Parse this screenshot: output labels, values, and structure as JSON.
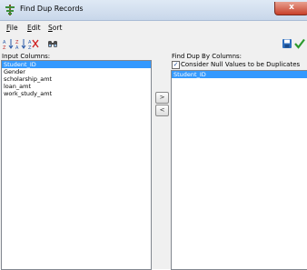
{
  "window": {
    "title": "Find Dup Records",
    "close_label": "x"
  },
  "menu": [
    {
      "label": "File",
      "mnemonic": "F"
    },
    {
      "label": "Edit",
      "mnemonic": "E"
    },
    {
      "label": "Sort",
      "mnemonic": "S"
    }
  ],
  "toolbar": {
    "icons": [
      "sort-ascending-icon",
      "sort-descending-icon",
      "clear-sort-icon",
      "find-icon",
      "save-icon",
      "apply-check-icon"
    ]
  },
  "left": {
    "label": "Input Columns:",
    "items": [
      "Student_ID",
      "Gender",
      "scholarship_amt",
      "loan_amt",
      "work_study_amt"
    ],
    "selected_index": 0
  },
  "buttons": {
    "add": ">",
    "remove": "<"
  },
  "right": {
    "label": "Find Dup By Columns:",
    "checkbox_label": "Consider Null Values to be Duplicates",
    "checkbox_checked": true,
    "check_mark": "✓",
    "items": [
      "Student_ID"
    ],
    "selected_index": 0
  },
  "colors": {
    "selection": "#3399ff",
    "accent_green": "#2e9a2e",
    "save_blue": "#2f6fbf"
  }
}
